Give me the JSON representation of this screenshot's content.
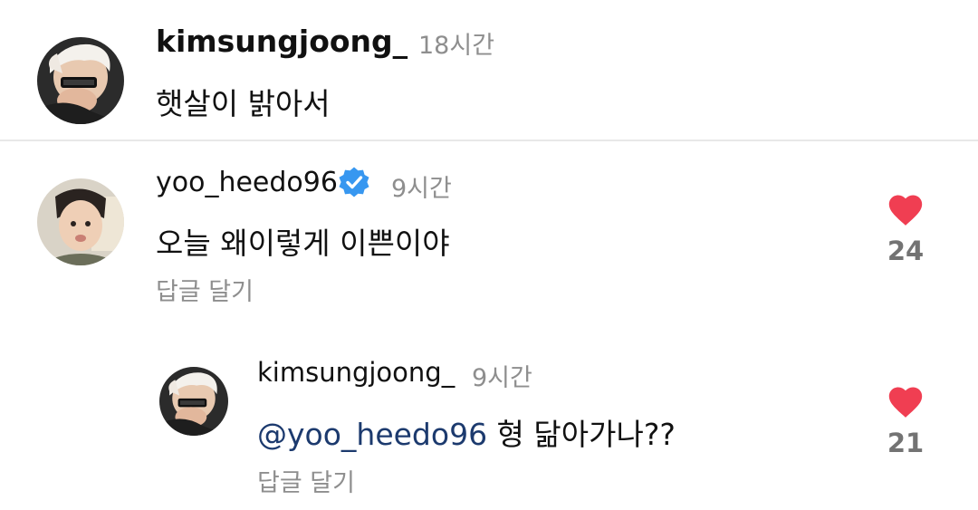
{
  "post": {
    "username": "kimsungjoong_",
    "time": "18시간",
    "text": "햇살이 밝아서",
    "avatar_icon": "avatar-kimsungjoong"
  },
  "comments": [
    {
      "username": "yoo_heedo96",
      "verified": true,
      "verified_icon": "verified-badge-icon",
      "verified_color": "#3797f0",
      "time": "9시간",
      "text": "오늘 왜이렇게 이쁜이야",
      "reply_label": "답글 달기",
      "like_icon": "heart-icon",
      "like_color": "#f03e52",
      "likes": "24",
      "avatar_icon": "avatar-yoo-heedo"
    },
    {
      "username": "kimsungjoong_",
      "time": "9시간",
      "mention": "@yoo_heedo96",
      "text": " 형 닮아가나??",
      "reply_label": "답글 달기",
      "like_icon": "heart-icon",
      "like_color": "#f03e52",
      "likes": "21",
      "avatar_icon": "avatar-kimsungjoong"
    }
  ],
  "colors": {
    "secondary_text": "#8e8e8e",
    "count_text": "#737373",
    "mention": "#1c3a6e",
    "divider": "#e8e8e8"
  }
}
